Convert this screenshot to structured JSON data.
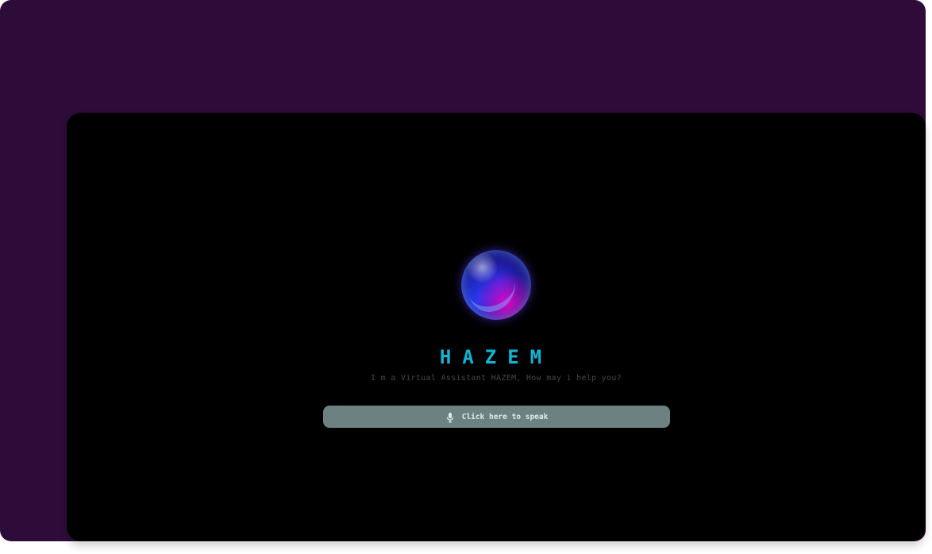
{
  "assistant": {
    "name": "HAZEM",
    "greeting": "I m a Virtual Assistant HAZEM, How may i help you?"
  },
  "speak_button": {
    "label": "Click here to speak",
    "icon": "microphone-icon"
  },
  "colors": {
    "outer_background": "#2e0c3a",
    "window_background": "#000000",
    "accent": "#0fb6d6",
    "button_background": "#6d8180",
    "button_text": "#d9efee",
    "greeting_text": "#3f4a4a"
  }
}
